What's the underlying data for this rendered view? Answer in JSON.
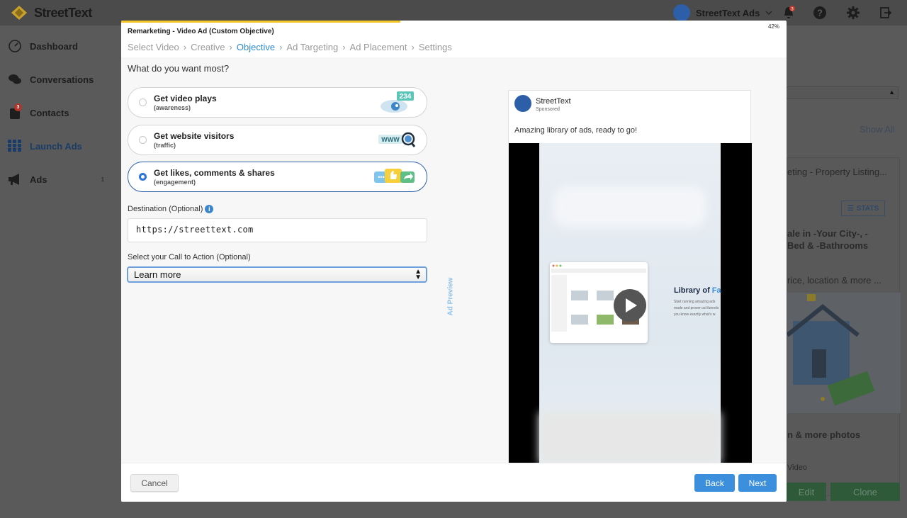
{
  "app": {
    "logo_text": "StreetText",
    "account_name": "StreetText Ads",
    "notification_count": "3"
  },
  "sidebar": {
    "items": [
      {
        "label": "Dashboard",
        "icon": "gauge-icon"
      },
      {
        "label": "Conversations",
        "icon": "chat-bubbles-icon"
      },
      {
        "label": "Contacts",
        "icon": "contacts-icon",
        "badge": "3"
      },
      {
        "label": "Launch Ads",
        "icon": "grid-icon"
      },
      {
        "label": "Ads",
        "icon": "megaphone-icon",
        "badge": "1"
      }
    ]
  },
  "background": {
    "show_all": "Show All",
    "card_title": "eting - Property Listing...",
    "stats_label": "STATS",
    "line1": "ale in -Your City-, -",
    "line2": "Bed & -Bathrooms",
    "line3": "rice, location & more ...",
    "photos": "n & more photos",
    "video": "Video",
    "edit": "Edit",
    "clone": "Clone"
  },
  "modal": {
    "title": "Remarketing - Video Ad (Custom Objective)",
    "progress_percent": "42%",
    "progress_value": 0.42,
    "breadcrumbs": [
      "Select Video",
      "Creative",
      "Objective",
      "Ad Targeting",
      "Ad Placement",
      "Settings"
    ],
    "current_step": "Objective",
    "question": "What do you want most?",
    "options": [
      {
        "title": "Get video plays",
        "subtitle": "(awareness)",
        "selected": false,
        "art_badge": "234"
      },
      {
        "title": "Get website visitors",
        "subtitle": "(traffic)",
        "selected": false,
        "art_badge": "WWW"
      },
      {
        "title": "Get likes, comments & shares",
        "subtitle": "(engagement)",
        "selected": true,
        "art_badge": ""
      }
    ],
    "destination_label": "Destination (Optional)",
    "destination_value": "https://streettext.com",
    "cta_label": "Select your Call to Action (Optional)",
    "cta_value": "Learn more",
    "ad_preview_tab": "Ad Preview",
    "preview": {
      "page_name": "StreetText",
      "sponsored": "Sponsored",
      "caption": "Amazing library of ads, ready to go!",
      "video_title_start": "Library of ",
      "video_title_accent": "Fa",
      "video_subtitle": "Start running amazing ads made and proven ad funnels you know exactly what's w"
    },
    "buttons": {
      "cancel": "Cancel",
      "back": "Back",
      "next": "Next"
    }
  },
  "colors": {
    "accent": "#3b8fdc",
    "progress": "#f4c629",
    "selected_border": "#2d5fa8"
  }
}
